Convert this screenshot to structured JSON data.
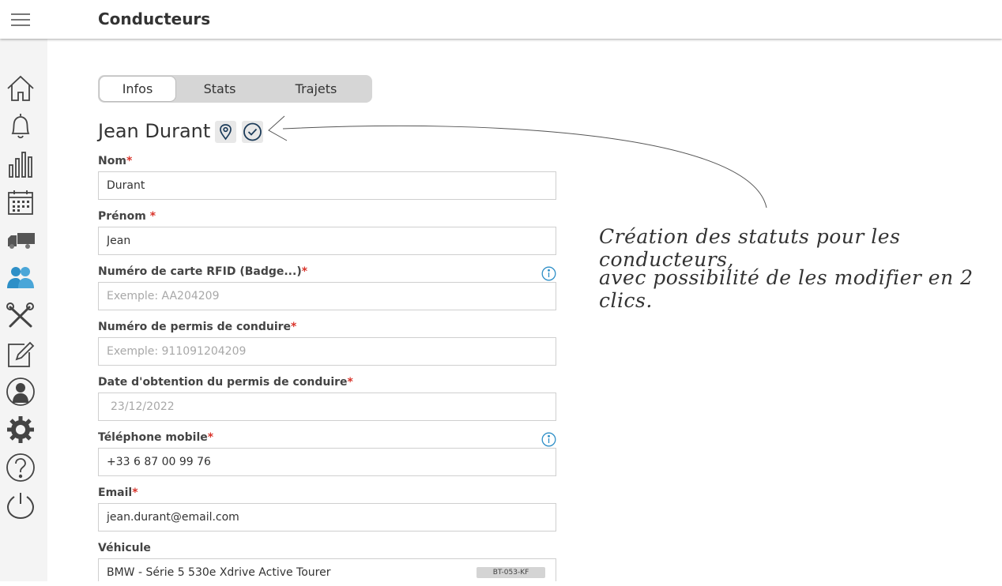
{
  "header": {
    "title": "Conducteurs"
  },
  "sidebar": {
    "items": [
      {
        "icon": "home-icon"
      },
      {
        "icon": "bell-icon"
      },
      {
        "icon": "bar-chart-icon"
      },
      {
        "icon": "calendar-icon"
      },
      {
        "icon": "truck-icon"
      },
      {
        "icon": "users-icon",
        "active": true
      },
      {
        "icon": "tools-icon"
      },
      {
        "icon": "edit-icon"
      },
      {
        "icon": "user-icon"
      },
      {
        "icon": "gear-icon"
      },
      {
        "icon": "help-icon"
      },
      {
        "icon": "power-icon"
      }
    ],
    "active_color": "#2e8fc7"
  },
  "tabs": [
    {
      "label": "Infos",
      "active": true
    },
    {
      "label": "Stats"
    },
    {
      "label": "Trajets"
    }
  ],
  "driver": {
    "name": "Jean Durant"
  },
  "form": {
    "nom": {
      "label": "Nom",
      "value": "Durant"
    },
    "prenom": {
      "label": "Prénom ",
      "value": "Jean"
    },
    "rfid": {
      "label": "Numéro de carte RFID (Badge...)",
      "placeholder": "Exemple: AA204209"
    },
    "permis": {
      "label": "Numéro de permis de conduire",
      "placeholder": "Exemple: 911091204209"
    },
    "date_permis": {
      "label": "Date d'obtention du permis de conduire",
      "value": "23/12/2022"
    },
    "telephone": {
      "label": "Téléphone mobile",
      "value": "+33 6 87 00 99 76"
    },
    "email": {
      "label": "Email",
      "value": "jean.durant@email.com"
    },
    "vehicule": {
      "label": "Véhicule",
      "value": "BMW - Série 5 530e Xdrive Active Tourer",
      "plate": "BT-053-KF"
    },
    "required_marker": "*"
  },
  "annotation": {
    "line1": "Création des statuts pour les conducteurs,",
    "line2": "avec possibilité de les modifier en 2 clics."
  },
  "colors": {
    "required": "#d9342b",
    "info": "#2e8fc7",
    "status_icon": "#1d3c5a"
  }
}
